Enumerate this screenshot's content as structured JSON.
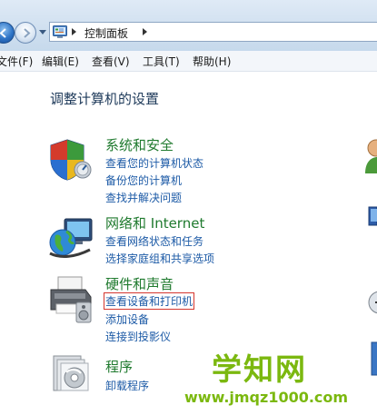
{
  "address": {
    "path_label": "控制面板"
  },
  "menu": [
    {
      "label": "文件(F)"
    },
    {
      "label": "编辑(E)"
    },
    {
      "label": "查看(V)"
    },
    {
      "label": "工具(T)"
    },
    {
      "label": "帮助(H)"
    }
  ],
  "page": {
    "title": "调整计算机的设置"
  },
  "categories": [
    {
      "title": "系统和安全",
      "icon": "shield-icon",
      "links": [
        "查看您的计算机状态",
        "备份您的计算机",
        "查找并解决问题"
      ]
    },
    {
      "title": "网络和 Internet",
      "icon": "network-globe-icon",
      "links": [
        "查看网络状态和任务",
        "选择家庭组和共享选项"
      ]
    },
    {
      "title": "硬件和声音",
      "icon": "printer-icon",
      "links": [
        "查看设备和打印机",
        "添加设备",
        "连接到投影仪"
      ]
    },
    {
      "title": "程序",
      "icon": "programs-icon",
      "links": [
        "卸载程序"
      ]
    }
  ],
  "watermark": {
    "brand": "学知网",
    "url": "www.jmqz1000.com"
  },
  "colors": {
    "category_title": "#1f7a2e",
    "link": "#1c5aa6",
    "highlight_box": "#d4362e",
    "watermark": "#7bb80f"
  }
}
